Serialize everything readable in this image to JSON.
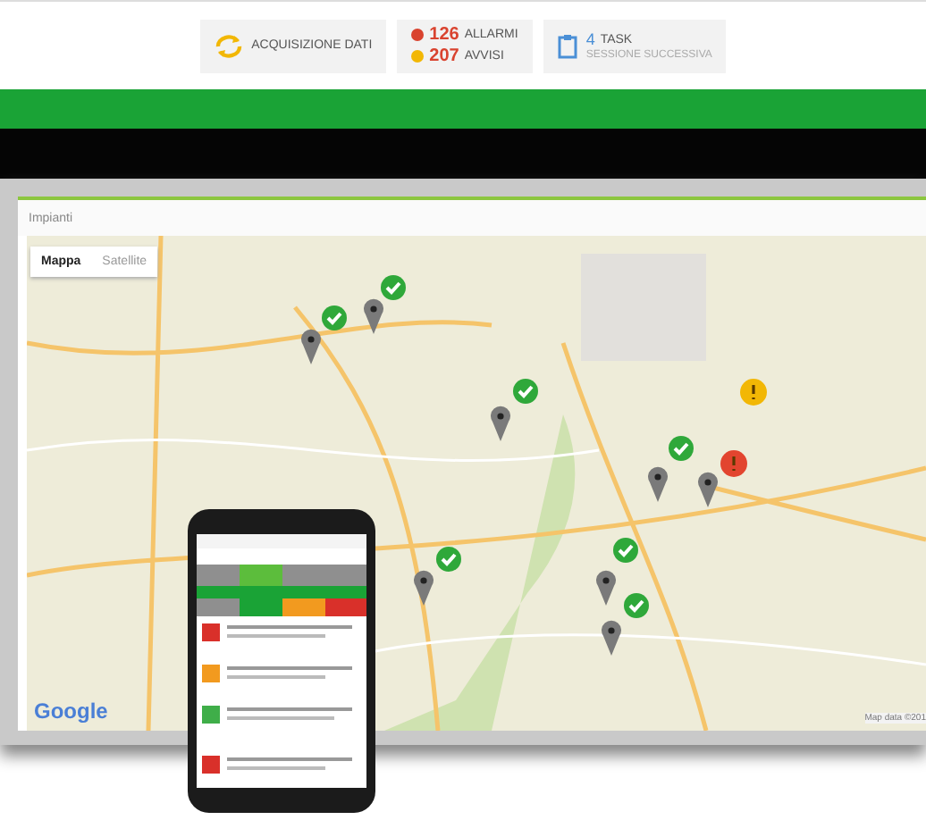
{
  "status_bar": {
    "sync_label": "ACQUISIZIONE DATI",
    "alarms": {
      "count": "126",
      "label": "ALLARMI"
    },
    "warnings": {
      "count": "207",
      "label": "AVVISI"
    },
    "tasks": {
      "count": "4",
      "label": "TASK",
      "sublabel": "SESSIONE SUCCESSIVA"
    }
  },
  "panel": {
    "title": "Impianti",
    "map_types": [
      {
        "label": "Mappa",
        "selected": true
      },
      {
        "label": "Satellite",
        "selected": false
      }
    ],
    "logo": "Google",
    "attribution": "Map data ©201"
  },
  "markers": [
    {
      "kind": "pin"
    },
    {
      "kind": "pin"
    },
    {
      "kind": "pin"
    },
    {
      "kind": "pin"
    },
    {
      "kind": "pin"
    },
    {
      "kind": "pin"
    },
    {
      "kind": "pin"
    },
    {
      "kind": "pin"
    },
    {
      "kind": "ok"
    },
    {
      "kind": "ok"
    },
    {
      "kind": "ok"
    },
    {
      "kind": "ok"
    },
    {
      "kind": "ok"
    },
    {
      "kind": "ok"
    },
    {
      "kind": "ok"
    },
    {
      "kind": "warning"
    },
    {
      "kind": "alarm"
    }
  ]
}
